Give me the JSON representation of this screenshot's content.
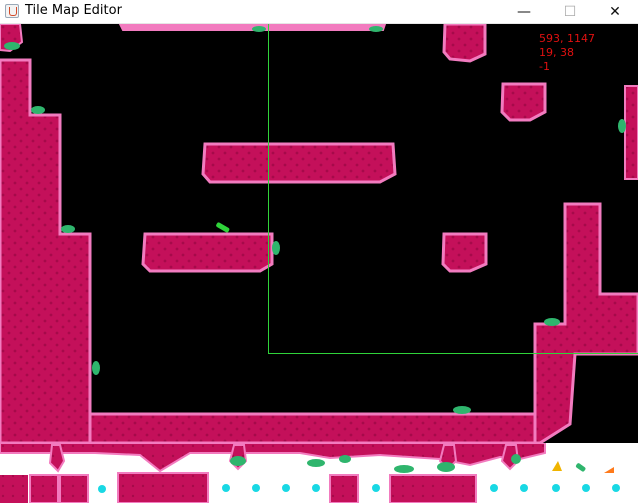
{
  "window": {
    "title": "Tile Map Editor",
    "controls": {
      "minimize": "—",
      "maximize": "☐",
      "close": "✕"
    }
  },
  "hud": {
    "cursor_pixel": "593, 1147",
    "cursor_tile": "19, 38",
    "tile_id": "-1"
  },
  "colors": {
    "terrain": "#c4105a",
    "terrain_edge": "#f27bbf",
    "grass": "#2fb56d",
    "background": "#000000",
    "selection": "#2fd33a",
    "hud_text": "#e01010",
    "palette_dot": "#19d8e4"
  },
  "icons": {
    "app": "java-cup-icon",
    "minimize": "minimize-icon",
    "maximize": "maximize-icon",
    "close": "close-icon"
  }
}
